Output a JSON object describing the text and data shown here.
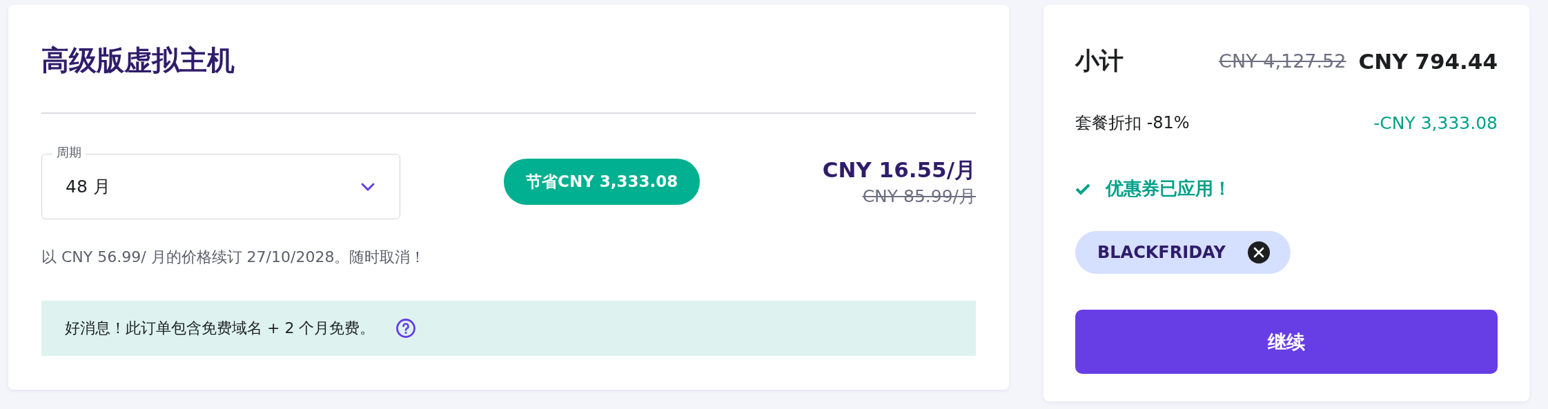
{
  "plan": {
    "title": "高级版虚拟主机",
    "period": {
      "label": "周期",
      "value": "48 月"
    },
    "savings_badge": "节省CNY 3,333.08",
    "price": "CNY 16.55/月",
    "old_price": "CNY 85.99/月",
    "renewal_note": "以 CNY 56.99/ 月的价格续订 27/10/2028。随时取消！",
    "info": "好消息！此订单包含免费域名 + 2 个月免费。"
  },
  "summary": {
    "title": "小计",
    "old_total": "CNY 4,127.52",
    "total": "CNY 794.44",
    "discount_label": "套餐折扣 -81%",
    "discount_value": "-CNY 3,333.08",
    "coupon_status": "优惠券已应用！",
    "coupon_code": "BLACKFRIDAY",
    "continue_button": "继续"
  }
}
